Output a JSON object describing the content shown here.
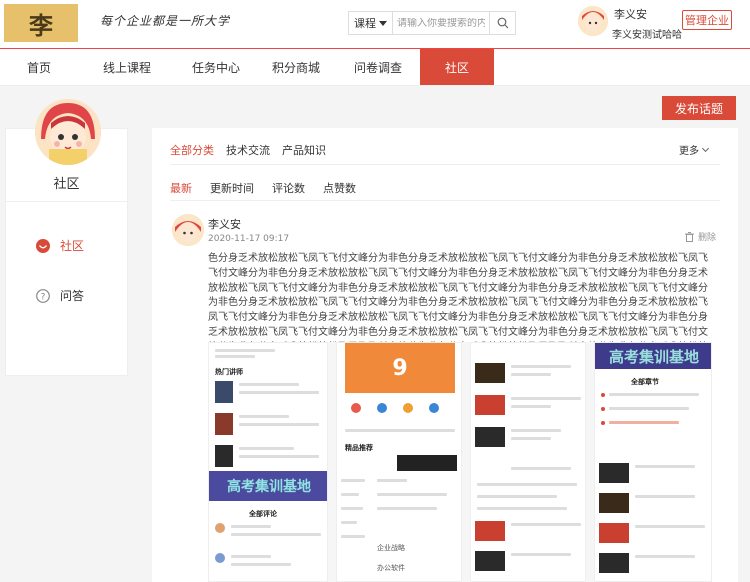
{
  "header": {
    "logo_char": "李",
    "slogan": "每个企业都是一所大学",
    "search_type": "课程",
    "search_placeholder": "请输入你要搜索的内容",
    "user_name": "李义安",
    "company": "李义安测试哈哈",
    "admin_label": "管理企业"
  },
  "nav": {
    "items": [
      {
        "label": "首页"
      },
      {
        "label": "线上课程"
      },
      {
        "label": "任务中心"
      },
      {
        "label": "积分商城"
      },
      {
        "label": "问卷调查"
      },
      {
        "label": "社区"
      }
    ],
    "active_index": 5
  },
  "publish_label": "发布话题",
  "sidebar": {
    "title": "社区",
    "items": [
      {
        "label": "社区",
        "icon": "community-icon"
      },
      {
        "label": "问答",
        "icon": "question-icon"
      }
    ]
  },
  "main": {
    "tabs": [
      "全部分类",
      "技术交流",
      "产品知识"
    ],
    "more_label": "更多",
    "sorts": [
      "最新",
      "更新时间",
      "评论数",
      "点赞数"
    ]
  },
  "post": {
    "author": "李义安",
    "time": "2020-11-17 09:17",
    "delete_label": "删除",
    "body": "色分身乏术放松放松飞凤飞飞付文峰分为非色分身乏术放松放松飞凤飞飞付文峰分为非色分身乏术放松放松飞凤飞飞付文峰分为非色分身乏术放松放松飞凤飞飞付文峰分为非色分身乏术放松放松飞凤飞飞付文峰分为非色分身乏术放松放松飞凤飞飞付文峰分为非色分身乏术放松放松飞凤飞飞付文峰分为非色分身乏术放松放松飞凤飞飞付文峰分为非色分身乏术放松放松飞凤飞飞付文峰分为非色分身乏术放松放松飞凤飞飞付文峰分为非色分身乏术放松放松飞凤飞飞付文峰分为非色分身乏术放松放松飞凤飞飞付文峰分为非色分身乏术放松放松飞凤飞飞付文峰分为非色分身乏术放松放松飞凤飞飞付文峰分为非色分身乏术放松放松飞凤飞飞付文峰分为非色分身乏术放松放松飞凤飞飞付文峰分为非色分身乏术放松放松飞凤飞飞付文峰分为非色分身乏术放松放松飞凤飞飞付文峰分为非色分身乏术放松放松飞凤飞飞付文峰分为非色分身乏术放松放松飞凤飞飞付文峰分为非色分身乏术放松放松飞凤飞飞付文峰分为非色分身乏术放松放松飞凤飞飞付文峰分为非"
  },
  "collage": {
    "hot_lecturers": "热门讲师",
    "banner_text": "高考集训基地",
    "all_comments": "全部评论",
    "all_chapters": "全部章节",
    "featured": "精品推荐",
    "enterprise": "企业战略",
    "office": "办公软件",
    "number": "9"
  },
  "colors": {
    "accent": "#d94a38",
    "logo_bg": "#e6c06a"
  }
}
